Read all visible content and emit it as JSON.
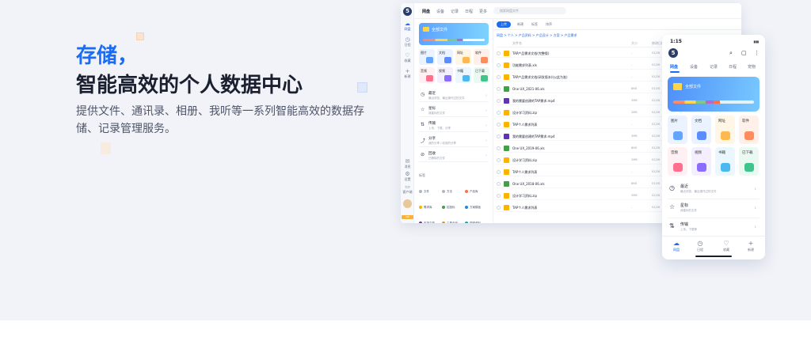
{
  "hero": {
    "title_blue": "存储，",
    "title_main": "智能高效的个人数据中心",
    "description": "提供文件、通讯录、相册、我听等一系列智能高效的数据存储、记录管理服务。"
  },
  "desktop": {
    "rail": [
      "网盘",
      "日程",
      "收藏",
      "新建",
      "消息",
      "设置",
      "客户端"
    ],
    "tabs": [
      "网盘",
      "设备",
      "记录",
      "日程",
      "更多"
    ],
    "search_placeholder": "搜索网盘文件",
    "all_files_label": "全部文件",
    "categories": [
      {
        "label": "图片",
        "bg": "#eaf3ff",
        "icon": "#63a4ff"
      },
      {
        "label": "文档",
        "bg": "#eaf3ff",
        "icon": "#5c8dff"
      },
      {
        "label": "网址",
        "bg": "#fff6e6",
        "icon": "#ffb84d"
      },
      {
        "label": "软件",
        "bg": "#fff1ea",
        "icon": "#ff8c5a"
      },
      {
        "label": "音频",
        "bg": "#fff0f3",
        "icon": "#ff6f8e"
      },
      {
        "label": "视频",
        "bg": "#f3efff",
        "icon": "#8b6cff"
      },
      {
        "label": "书籍",
        "bg": "#eaf7ff",
        "icon": "#4bb8f2"
      },
      {
        "label": "已下载",
        "bg": "#eafaf3",
        "icon": "#3fc58c"
      }
    ],
    "sections": [
      {
        "icon": "◷",
        "title": "最近",
        "sub": "最近浏览、最近操作过的文件"
      },
      {
        "icon": "☆",
        "title": "星标",
        "sub": "我星标的文件"
      },
      {
        "icon": "⇅",
        "title": "传输",
        "sub": "上传、下载、分享"
      },
      {
        "icon": "⤴",
        "title": "分享",
        "sub": "我的分享 / 收到的分享"
      },
      {
        "icon": "⊘",
        "title": "回收",
        "sub": "已删除的文件"
      }
    ],
    "tag_header": "标签",
    "tags": [
      {
        "label": "文件",
        "color": "#b0b6c4"
      },
      {
        "label": "方法",
        "color": "#b0b6c4"
      },
      {
        "label": "产品库",
        "color": "#ff7043"
      },
      {
        "label": "需求库",
        "color": "#ffb300"
      },
      {
        "label": "招投标",
        "color": "#43a047"
      },
      {
        "label": "方案模板",
        "color": "#1e88e5"
      },
      {
        "label": "市场文档",
        "color": "#8e24aa"
      },
      {
        "label": "工具产品",
        "color": "#fb8c00"
      },
      {
        "label": "视频资料",
        "color": "#00acc1"
      },
      {
        "label": "产品图片",
        "color": "#e53935"
      },
      {
        "label": "流程图",
        "color": "#5e35b1"
      },
      {
        "label": "合同",
        "color": "#3949ab"
      }
    ],
    "toolbar": {
      "upload": "上传",
      "chips": [
        "新建",
        "标签",
        "排序"
      ]
    },
    "breadcrumb": "网盘 > 个人 > 产品资料 > 产品设计 > 方案 > 产品需求",
    "columns": [
      "文件名",
      "大小",
      "修改日期"
    ],
    "files": [
      {
        "name": "TAP产品需求文档(完整版)",
        "color": "#ffb300",
        "size": "-",
        "date": "02/26"
      },
      {
        "name": "功能需求列表.xls",
        "color": "#ffb300",
        "size": "-",
        "date": "02/26"
      },
      {
        "name": "TAP产品需求文档(研发版本)(以此为准)",
        "color": "#ffb300",
        "size": "-",
        "date": "02/26"
      },
      {
        "name": "One UX_2021-06.xls",
        "color": "#43a047",
        "size": "8KB",
        "date": "02/26"
      },
      {
        "name": "我的需要创建的TAP需求.mp4",
        "color": "#5e35b1",
        "size": "3MB",
        "date": "02/26"
      },
      {
        "name": "设计学习资料.zip",
        "color": "#ffb300",
        "size": "2MB",
        "date": "02/26"
      },
      {
        "name": "TAP个人需求列表",
        "color": "#ffb300",
        "size": "-",
        "date": "02/26"
      },
      {
        "name": "我的需要创建的TAP需求.mp4",
        "color": "#5e35b1",
        "size": "3MB",
        "date": "02/26"
      },
      {
        "name": "One UX_2019-06.xls",
        "color": "#43a047",
        "size": "8KB",
        "date": "02/26"
      },
      {
        "name": "设计学习资料.zip",
        "color": "#ffb300",
        "size": "2MB",
        "date": "02/26"
      },
      {
        "name": "TAP个人需求列表",
        "color": "#ffb300",
        "size": "-",
        "date": "02/26"
      },
      {
        "name": "One UX_2018-06.xls",
        "color": "#43a047",
        "size": "8KB",
        "date": "02/26"
      },
      {
        "name": "设计学习资料.zip",
        "color": "#ffb300",
        "size": "2MB",
        "date": "02/26"
      },
      {
        "name": "TAP个人需求列表",
        "color": "#ffb300",
        "size": "-",
        "date": "02/26"
      }
    ]
  },
  "phone": {
    "time": "1:15",
    "tabs": [
      "网盘",
      "设备",
      "记录",
      "日程",
      "宠物"
    ],
    "all_files_label": "全部文件",
    "categories": [
      {
        "label": "图片",
        "bg": "#eaf3ff",
        "icon": "#63a4ff"
      },
      {
        "label": "文档",
        "bg": "#eaf3ff",
        "icon": "#5c8dff"
      },
      {
        "label": "网址",
        "bg": "#fff6e6",
        "icon": "#ffb84d"
      },
      {
        "label": "软件",
        "bg": "#fff1ea",
        "icon": "#ff8c5a"
      },
      {
        "label": "音频",
        "bg": "#fff0f3",
        "icon": "#ff6f8e"
      },
      {
        "label": "视频",
        "bg": "#f3efff",
        "icon": "#8b6cff"
      },
      {
        "label": "书籍",
        "bg": "#eaf7ff",
        "icon": "#4bb8f2"
      },
      {
        "label": "已下载",
        "bg": "#eafaf3",
        "icon": "#3fc58c"
      }
    ],
    "sections": [
      {
        "icon": "◷",
        "title": "最近",
        "sub": "最近浏览、最近操作过的文件"
      },
      {
        "icon": "☆",
        "title": "星标",
        "sub": "我星标的文件"
      },
      {
        "icon": "⇅",
        "title": "传输",
        "sub": "上传、下载等"
      }
    ],
    "nav": [
      "网盘",
      "日程",
      "收藏",
      "新建"
    ]
  }
}
